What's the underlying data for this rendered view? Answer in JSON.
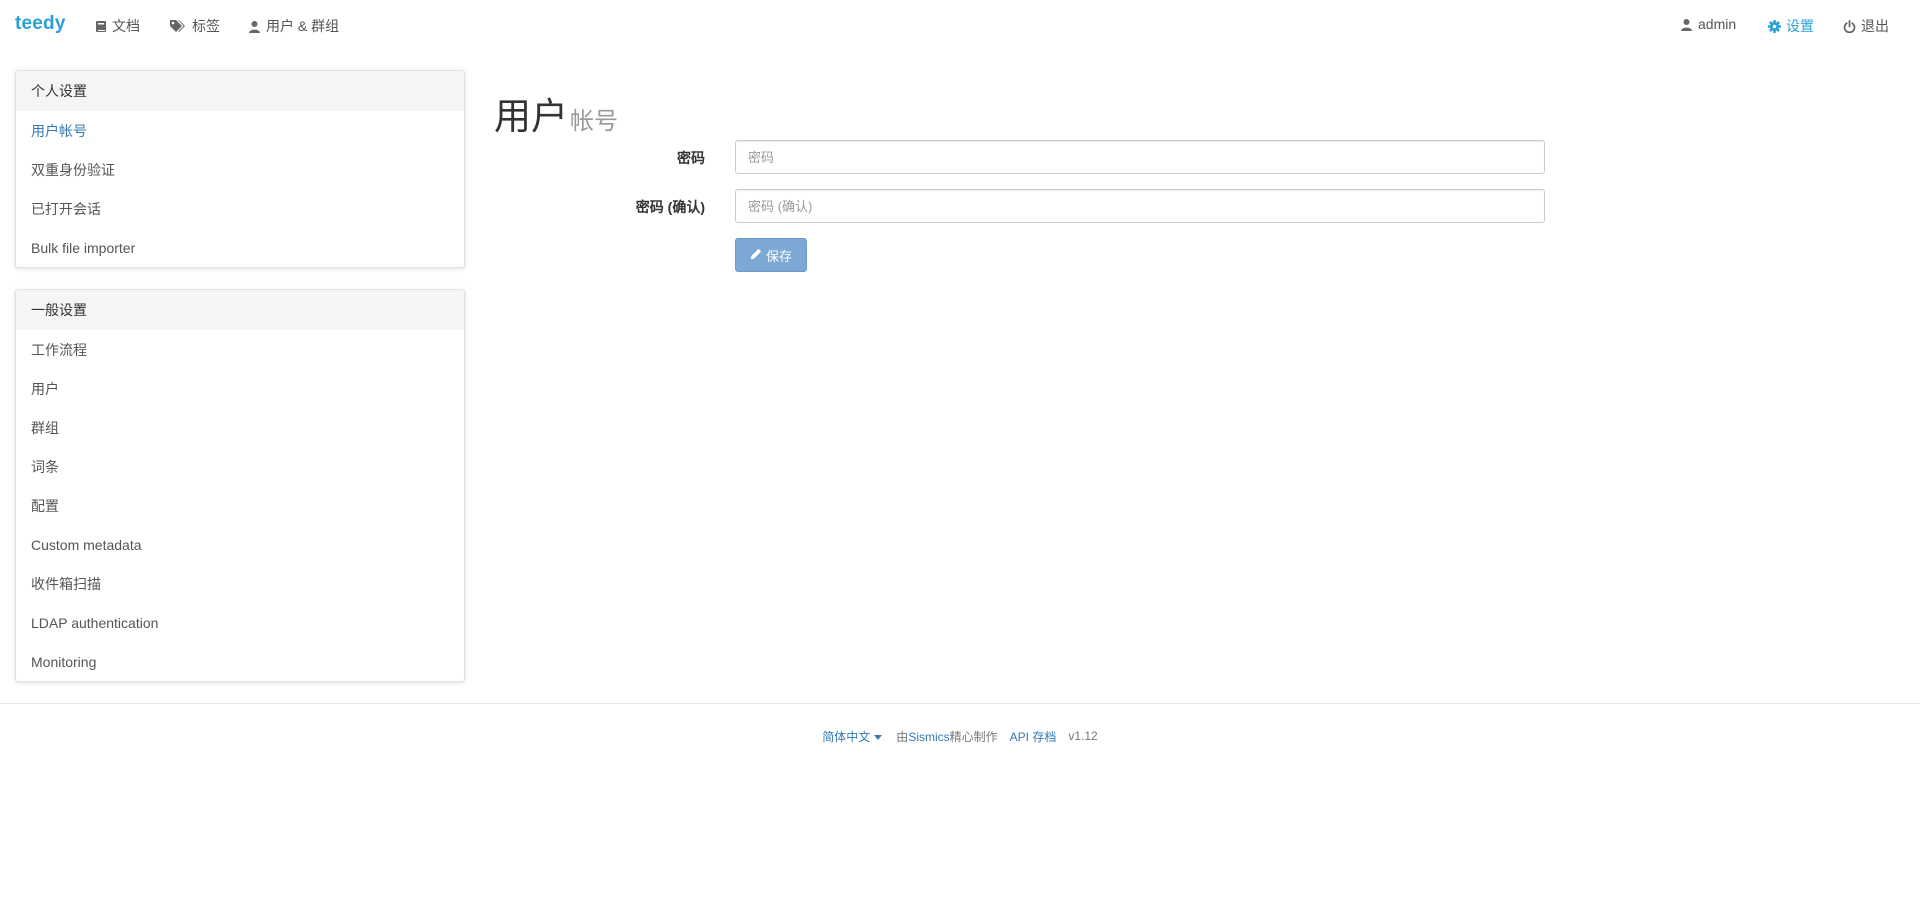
{
  "navbar": {
    "brand": "teedy",
    "left": [
      {
        "label": "文档",
        "icon": "book-icon"
      },
      {
        "label": "标签",
        "icon": "tags-icon"
      },
      {
        "label": "用户 & 群组",
        "icon": "user-icon"
      }
    ],
    "right": [
      {
        "label": "admin",
        "icon": "user-icon"
      },
      {
        "label": "设置",
        "icon": "gear-icon",
        "active": true
      },
      {
        "label": "退出",
        "icon": "power-icon"
      }
    ],
    "accent_color": "#2aa0d8"
  },
  "sidebar": {
    "personal": {
      "heading": "个人设置",
      "items": [
        {
          "label": "用户帐号",
          "active": true
        },
        {
          "label": "双重身份验证"
        },
        {
          "label": "已打开会话"
        },
        {
          "label": "Bulk file importer"
        }
      ]
    },
    "general": {
      "heading": "一般设置",
      "items": [
        {
          "label": "工作流程"
        },
        {
          "label": "用户"
        },
        {
          "label": "群组"
        },
        {
          "label": "词条"
        },
        {
          "label": "配置"
        },
        {
          "label": "Custom metadata"
        },
        {
          "label": "收件箱扫描"
        },
        {
          "label": "LDAP authentication"
        },
        {
          "label": "Monitoring"
        }
      ]
    }
  },
  "main": {
    "title": "用户",
    "subtitle": "帐号",
    "form": {
      "password_label": "密码",
      "password_placeholder": "密码",
      "password_value": "",
      "confirm_label": "密码 (确认)",
      "confirm_placeholder": "密码 (确认)",
      "confirm_value": "",
      "save_label": "保存"
    }
  },
  "footer": {
    "language": "简体中文",
    "made_prefix": "由",
    "made_link": "Sismics",
    "made_suffix": "精心制作",
    "api_link": "API 存档",
    "version": "v1.12"
  },
  "colors": {
    "link": "#337ab7",
    "button": "#7ba9d4"
  }
}
